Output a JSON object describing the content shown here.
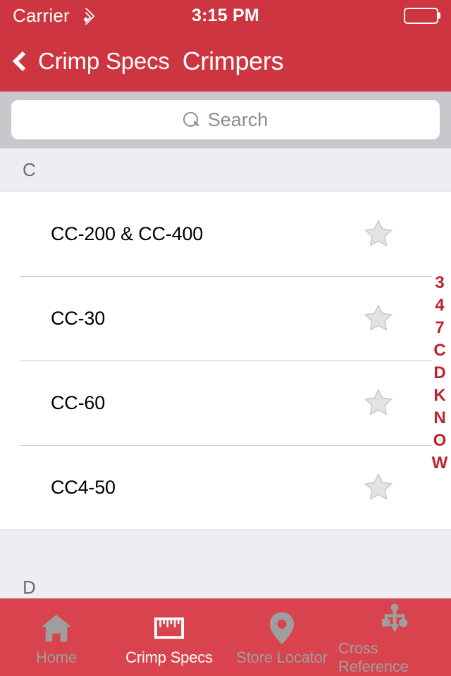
{
  "status_bar": {
    "carrier": "Carrier",
    "wifi_icon": "wifi-icon",
    "time": "3:15 PM",
    "battery_icon": "battery-icon"
  },
  "nav_bar": {
    "back_icon": "chevron-left-icon",
    "back_label": "Crimp Specs",
    "title": "Crimpers",
    "background_color": "#cd3540"
  },
  "search": {
    "placeholder": "Search",
    "value": "",
    "icon": "search-icon"
  },
  "list": {
    "sections": [
      {
        "header": "C",
        "rows": [
          {
            "title": "CC-200 & CC-400",
            "favorite_icon": "star-icon",
            "favorited": false
          },
          {
            "title": "CC-30",
            "favorite_icon": "star-icon",
            "favorited": false
          },
          {
            "title": "CC-60",
            "favorite_icon": "star-icon",
            "favorited": false
          },
          {
            "title": "CC4-50",
            "favorite_icon": "star-icon",
            "favorited": false
          }
        ]
      },
      {
        "header": "D",
        "rows": []
      }
    ]
  },
  "section_index": {
    "letters": [
      "3",
      "4",
      "7",
      "C",
      "D",
      "K",
      "N",
      "O",
      "W"
    ],
    "color": "#c0212e"
  },
  "tab_bar": {
    "background_color": "#d9434e",
    "active_color": "#ffffff",
    "inactive_color": "#9e9e9e",
    "tabs": [
      {
        "label": "Home",
        "icon": "home-icon",
        "active": false
      },
      {
        "label": "Crimp Specs",
        "icon": "ruler-icon",
        "active": true
      },
      {
        "label": "Store Locator",
        "icon": "map-pin-icon",
        "active": false
      },
      {
        "label": "Cross Reference",
        "icon": "cross-reference-icon",
        "active": false
      }
    ]
  }
}
